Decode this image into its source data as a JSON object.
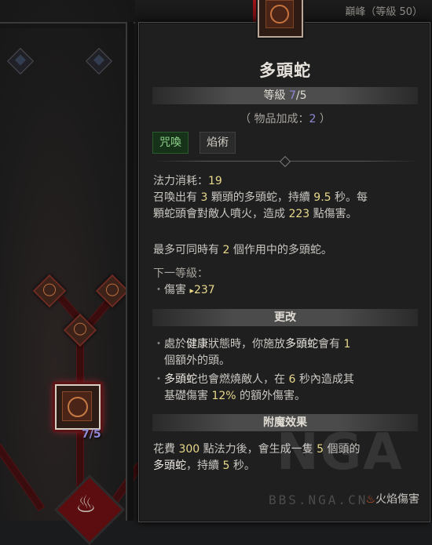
{
  "header": {
    "peak_label": "巔峰（等級 50）"
  },
  "tree": {
    "node_rank": "7/5"
  },
  "tooltip": {
    "title": "多頭蛇",
    "rank_label": "等級 ",
    "rank_current": "7",
    "rank_max": "/5",
    "item_bonus_prefix": "（ 物品加成：",
    "item_bonus_value": "2",
    "item_bonus_suffix": " ）",
    "tags": [
      "咒喚",
      "焰術"
    ],
    "mana_label": "法力消耗：",
    "mana_value": "19",
    "desc1_a": "召喚出有 ",
    "desc1_heads": "3",
    "desc1_b": " 顆頭的多頭蛇，持續 ",
    "desc1_dur": "9.5",
    "desc1_c": " 秒。每",
    "desc2_a": "顆蛇頭會對敵人噴火，造成 ",
    "desc2_dmg": "223",
    "desc2_b": " 點傷害。",
    "desc3_a": "最多可同時有 ",
    "desc3_num": "2",
    "desc3_b": " 個作用中的多頭蛇。",
    "next_level_label": "下一等級：",
    "next_level_item_label": "傷害 ",
    "next_level_item_value": "237",
    "section_upgrade": "更改",
    "upg1_a": "處於",
    "upg1_b": "健康",
    "upg1_c": "狀態時，你施放",
    "upg1_d": "多頭蛇",
    "upg1_e": "會有 ",
    "upg1_f": "1",
    "upg1_g": "個額外的頭。",
    "upg2_a": "多頭蛇",
    "upg2_b": "也會燃燒敵人，在 ",
    "upg2_c": "6",
    "upg2_d": " 秒內造成其",
    "upg2_e": "基礎傷害 ",
    "upg2_f": "12%",
    "upg2_g": " 的額外傷害。",
    "section_enchant": "附魔效果",
    "ench1_a": "花費 ",
    "ench1_b": "300",
    "ench1_c": " 點法力後，會生成一隻 ",
    "ench1_d": "5",
    "ench1_e": " 個頭的",
    "ench2_a": "多頭蛇",
    "ench2_b": "，持續 ",
    "ench2_c": "5",
    "ench2_d": " 秒。",
    "footer_icon": "flame-icon",
    "footer_label": "火焰傷害"
  },
  "watermark": {
    "logo": "NGA",
    "url": "BBS.NGA.CN"
  }
}
